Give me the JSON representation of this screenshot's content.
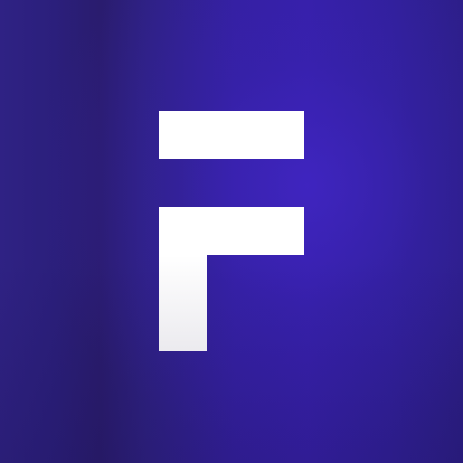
{
  "logo": {
    "icon": "letter-f-logo-icon",
    "colors": {
      "glyph": "#ffffff",
      "background_primary": "#3420a0",
      "background_dark": "#2a1c6e",
      "glow": "#4628d2"
    }
  }
}
